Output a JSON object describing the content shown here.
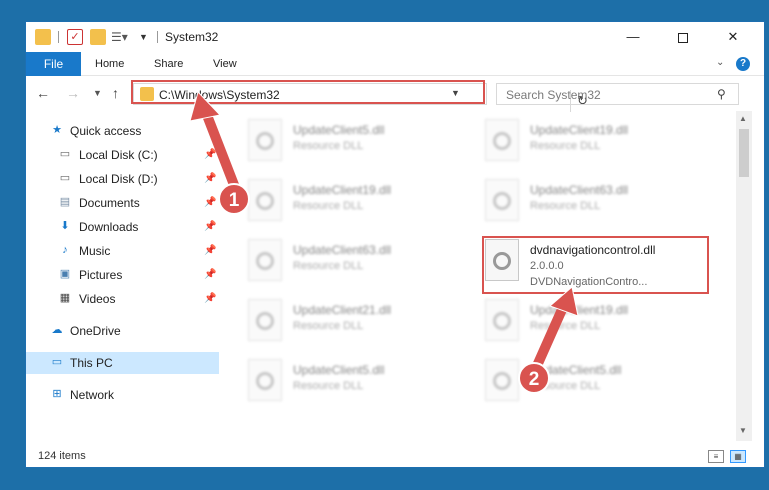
{
  "window": {
    "title": "System32",
    "controls": {
      "minimize": "—",
      "close": "✕"
    }
  },
  "ribbon": {
    "tabs": [
      "File",
      "Home",
      "Share",
      "View"
    ]
  },
  "navigation": {
    "address": "C:\\Windows\\System32",
    "search_placeholder": "Search System32"
  },
  "sidebar": {
    "items": [
      {
        "label": "Quick access",
        "icon": "star-icon",
        "pinned": false
      },
      {
        "label": "Local Disk (C:)",
        "icon": "drive-icon",
        "pinned": true
      },
      {
        "label": "Local Disk (D:)",
        "icon": "drive-icon",
        "pinned": true
      },
      {
        "label": "Documents",
        "icon": "documents-icon",
        "pinned": true
      },
      {
        "label": "Downloads",
        "icon": "download-icon",
        "pinned": true
      },
      {
        "label": "Music",
        "icon": "music-icon",
        "pinned": true
      },
      {
        "label": "Pictures",
        "icon": "pictures-icon",
        "pinned": true
      },
      {
        "label": "Videos",
        "icon": "videos-icon",
        "pinned": true
      },
      {
        "label": "OneDrive",
        "icon": "cloud-icon",
        "pinned": false
      },
      {
        "label": "This PC",
        "icon": "computer-icon",
        "pinned": false,
        "selected": true
      },
      {
        "label": "Network",
        "icon": "network-icon",
        "pinned": false
      }
    ]
  },
  "files": [
    {
      "name": "UpdateClient5.dll",
      "desc": "Resource DLL",
      "blurred": true
    },
    {
      "name": "UpdateClient19.dll",
      "desc": "Resource DLL",
      "blurred": true
    },
    {
      "name": "UpdateClient19.dll",
      "desc": "Resource DLL",
      "blurred": true
    },
    {
      "name": "UpdateClient63.dll",
      "desc": "Resource DLL",
      "blurred": true
    },
    {
      "name": "UpdateClient63.dll",
      "desc": "Resource DLL",
      "blurred": true
    },
    {
      "name": "dvdnavigationcontrol.dll",
      "desc": "2.0.0.0",
      "desc2": "DVDNavigationContro...",
      "blurred": false
    },
    {
      "name": "UpdateClient21.dll",
      "desc": "Resource DLL",
      "blurred": true
    },
    {
      "name": "UpdateClient19.dll",
      "desc": "Resource DLL",
      "blurred": true
    },
    {
      "name": "UpdateClient5.dll",
      "desc": "Resource DLL",
      "blurred": true
    },
    {
      "name": "UpdateClient5.dll",
      "desc": "Resource DLL",
      "blurred": true
    }
  ],
  "status": {
    "item_count": "124 items"
  },
  "annotations": {
    "step1": "1",
    "step2": "2",
    "color": "#d9534f"
  }
}
